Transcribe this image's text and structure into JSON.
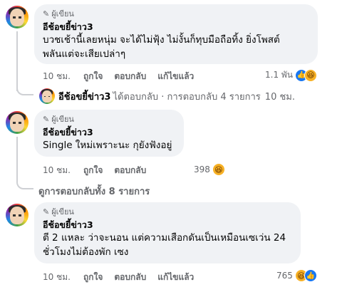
{
  "badge_label": "ผู้เขียน",
  "comments": [
    {
      "author": "อีช้อขยี้ข่าว3",
      "text": "บวชเช้านี้เลยหนุ่ม จะได้ไม่ฟุ้ง ไม่งั้นก็ทุบมือถือทิ้ง ยิ่งโพสต์\nพลันแต่จะเสียเปล่าๆ",
      "time": "10 ชม.",
      "like": "ถูกใจ",
      "reply": "ตอบกลับ",
      "edit": "แก้ไขแล้ว",
      "reaction_count": "1.1 พัน",
      "reactions": [
        "like-icon",
        "haha-icon"
      ]
    },
    {
      "author": "อีช้อขยี้ข่าว3",
      "text": "Single ใหม่เพราะนะ กุยังฟังอยู่",
      "time": "10 ชม.",
      "like": "ถูกใจ",
      "reply": "ตอบกลับ",
      "reaction_count": "398",
      "reactions": [
        "haha-icon"
      ]
    },
    {
      "author": "อีช้อขยี้ข่าว3",
      "text": "ตี 2 แหละ ว่าจะนอน แต่ความเสือกดันเป็นเหมือนเซเว่น 24\nชั่วโมงไม่ต้องพัก เซง",
      "time": "10 ชม.",
      "like": "ถูกใจ",
      "reply": "ตอบกลับ",
      "edit": "แก้ไขแล้ว",
      "reaction_count": "765",
      "reactions": [
        "haha-icon",
        "like-icon"
      ]
    }
  ],
  "reply_summary": {
    "name": "อีช้อขยี้ข่าว3",
    "text": "ได้ตอบกลับ · การตอบกลับ 4 รายการ",
    "time": "10 ชม."
  },
  "view_replies": "ดูการตอบกลับทั้ง 8 รายการ"
}
